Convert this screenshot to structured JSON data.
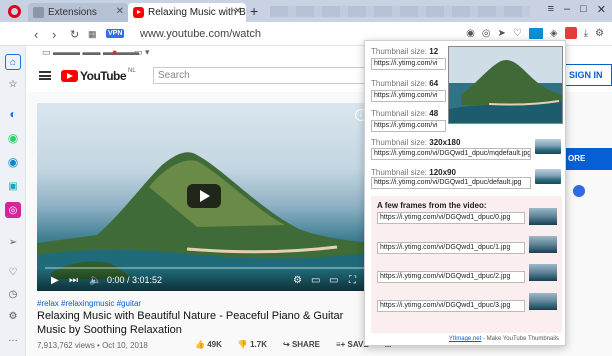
{
  "browser": {
    "tabs": [
      {
        "label": "Extensions"
      },
      {
        "label": "Relaxing Music with Beautif"
      }
    ],
    "address": {
      "vpn_badge": "VPN",
      "url": "www.youtube.com/watch"
    }
  },
  "youtube": {
    "logo_text": "YouTube",
    "logo_region": "NL",
    "search_placeholder": "Search",
    "sign_in": "SIGN IN",
    "more_button": "ORE",
    "video": {
      "time": "0:00 / 3:01:52",
      "info_glyph": "i",
      "tags": "#relax #relaxingmusic #guitar",
      "title": "Relaxing Music with Beautiful Nature - Peaceful Piano & Guitar Music by Soothing Relaxation",
      "views_date": "7,913,762 views • Oct 10, 2018",
      "likes": "49K",
      "dislikes": "1.7K",
      "share": "SHARE",
      "save": "SAVE",
      "more": "..."
    }
  },
  "popup": {
    "thumbs": [
      {
        "label": "Thumbnail size: ",
        "size": "12",
        "url": "https://i.ytimg.com/vi"
      },
      {
        "label": "Thumbnail size: ",
        "size": "64",
        "url": "https://i.ytimg.com/vi"
      },
      {
        "label": "Thumbnail size: ",
        "size": "48",
        "url": "https://i.ytimg.com/vi"
      },
      {
        "label": "Thumbnail size: ",
        "size": "320x180",
        "url": "https://i.ytimg.com/vi/DGQwd1_dpuc/mqdefault.jpg"
      },
      {
        "label": "Thumbnail size: ",
        "size": "120x90",
        "url": "https://i.ytimg.com/vi/DGQwd1_dpuc/default.jpg"
      }
    ],
    "frames_label": "A few frames from the video:",
    "frames": [
      "https://i.ytimg.com/vi/DGQwd1_dpuc/0.jpg",
      "https://i.ytimg.com/vi/DGQwd1_dpuc/1.jpg",
      "https://i.ytimg.com/vi/DGQwd1_dpuc/2.jpg",
      "https://i.ytimg.com/vi/DGQwd1_dpuc/3.jpg"
    ],
    "footer_link": "YtImage.net",
    "footer_text": " - Make YouTube Thumbnails"
  }
}
